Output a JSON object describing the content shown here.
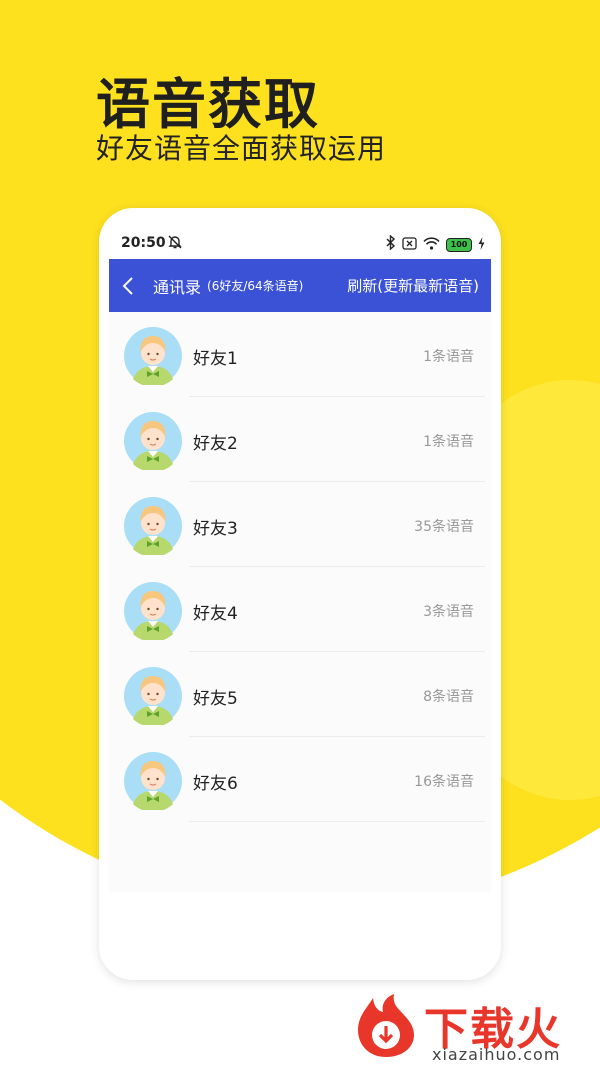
{
  "promo": {
    "headline": "语音获取",
    "subheadline": "好友语音全面获取运用"
  },
  "status_bar": {
    "time": "20:50",
    "battery_level": "100"
  },
  "app_bar": {
    "title": "通讯录",
    "count": "(6好友/64条语音)",
    "refresh_label": "刷新(更新最新语音)"
  },
  "friends": [
    {
      "name": "好友1",
      "voice_count": "1条语音"
    },
    {
      "name": "好友2",
      "voice_count": "1条语音"
    },
    {
      "name": "好友3",
      "voice_count": "35条语音"
    },
    {
      "name": "好友4",
      "voice_count": "3条语音"
    },
    {
      "name": "好友5",
      "voice_count": "8条语音"
    },
    {
      "name": "好友6",
      "voice_count": "16条语音"
    }
  ],
  "brand": {
    "name": "下载火",
    "url": "xiazaihuo.com"
  },
  "colors": {
    "background_yellow": "#FDE11F",
    "app_bar_blue": "#3B52D6",
    "brand_red": "#E8362A"
  }
}
